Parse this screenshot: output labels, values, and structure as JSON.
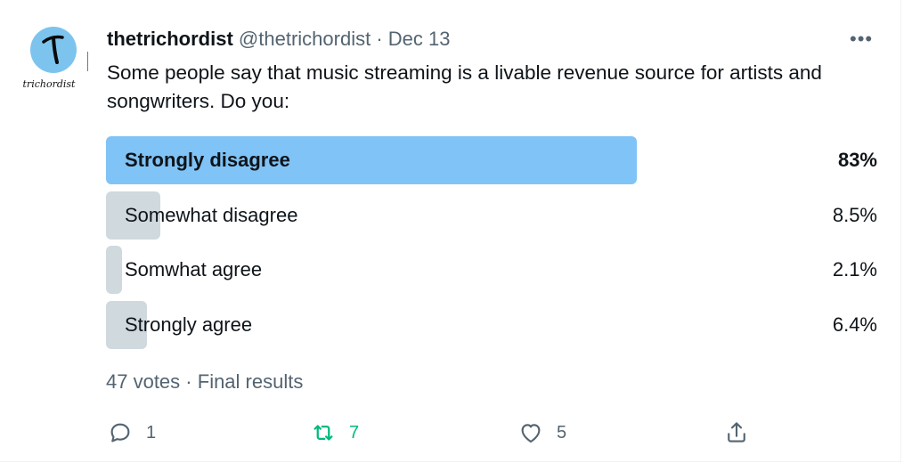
{
  "author": {
    "name": "thetrichordist",
    "handle": "@thetrichordist",
    "separator": "·",
    "date": "Dec 13",
    "avatar_text": "trichordist",
    "avatar_color": "#7cc4ee"
  },
  "more_label": "•••",
  "tweet_text": "Some people say that music streaming is a livable revenue source for artists and songwriters.  Do you:",
  "poll": {
    "options": [
      {
        "label": "Strongly disagree",
        "percent_label": "83%",
        "percent": 83,
        "winner": true
      },
      {
        "label": "Somewhat disagree",
        "percent_label": "8.5%",
        "percent": 8.5,
        "winner": false
      },
      {
        "label": "Somwhat agree",
        "percent_label": "2.1%",
        "percent": 2.1,
        "winner": false
      },
      {
        "label": "Strongly agree",
        "percent_label": "6.4%",
        "percent": 6.4,
        "winner": false
      }
    ],
    "votes": "47 votes",
    "separator": "·",
    "status": "Final results",
    "colors": {
      "winner_bar": "#80c3f6",
      "other_bar": "#cfd9de"
    }
  },
  "actions": {
    "reply": {
      "icon": "reply-icon",
      "count": "1"
    },
    "retweet": {
      "icon": "retweet-icon",
      "count": "7",
      "color": "#00ba7c"
    },
    "like": {
      "icon": "heart-icon",
      "count": "5"
    },
    "share": {
      "icon": "share-icon"
    }
  }
}
